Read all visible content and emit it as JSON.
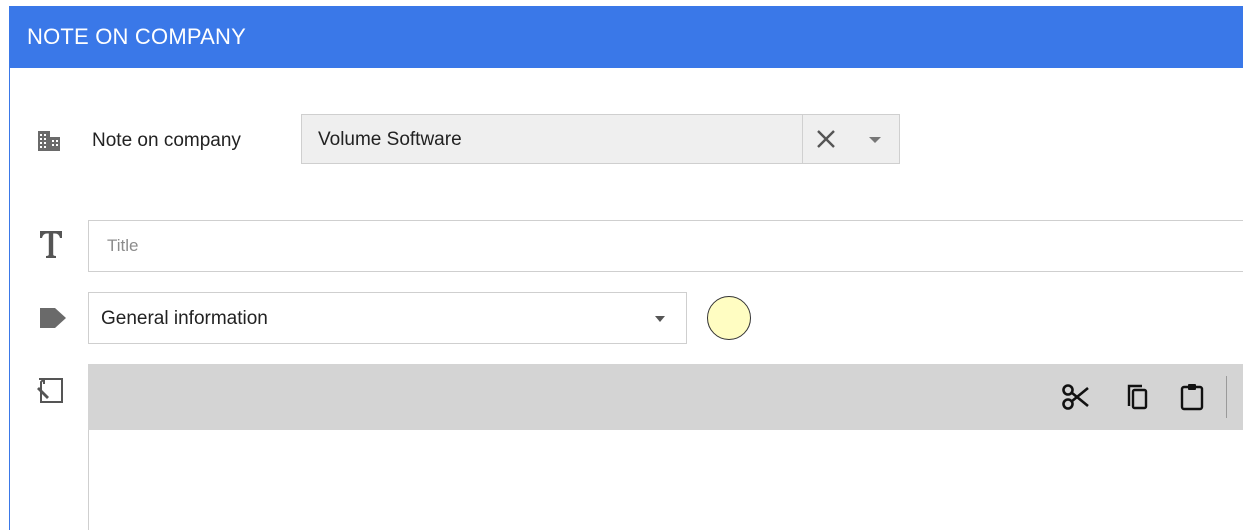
{
  "header": {
    "title": "NOTE ON COMPANY"
  },
  "company": {
    "label": "Note on company",
    "value": "Volume Software",
    "icon": "building-icon"
  },
  "title_field": {
    "placeholder": "Title",
    "value": "",
    "icon": "text-t-icon"
  },
  "category": {
    "value": "General information",
    "icon": "tag-icon",
    "color": "#fffdc2"
  },
  "editor": {
    "icon": "note-edit-icon",
    "toolbar": [
      "scissors-icon",
      "copy-icon",
      "paste-icon"
    ]
  },
  "colors": {
    "accent": "#3a78e8",
    "toolbar": "#d4d4d4"
  }
}
